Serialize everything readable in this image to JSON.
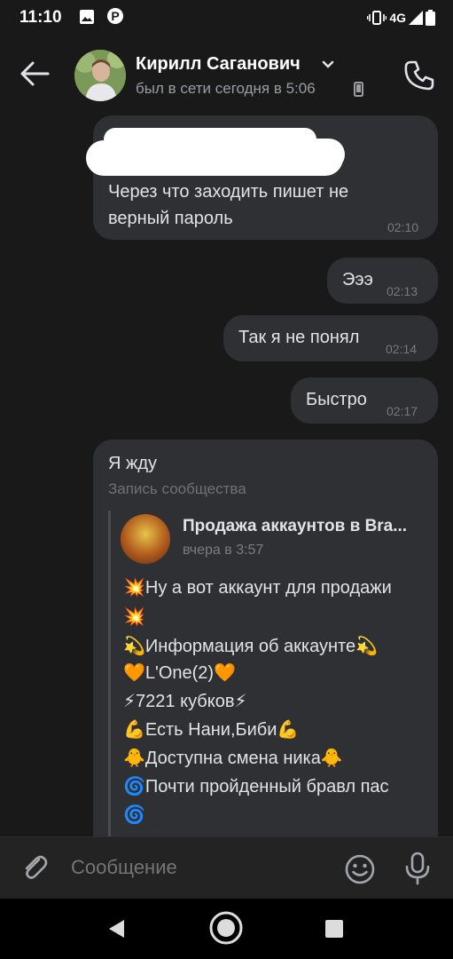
{
  "status_bar": {
    "time": "11:10",
    "network": "4G"
  },
  "header": {
    "contact_name": "Кирилл Саганович",
    "last_seen": "был в сети сегодня в 5:06"
  },
  "messages": [
    {
      "text": "Через что заходить пишет не верный пароль",
      "time": "02:10"
    },
    {
      "text": "Эээ",
      "time": "02:13"
    },
    {
      "text": "Так я не понял",
      "time": "02:14"
    },
    {
      "text": "Быстро",
      "time": "02:17"
    }
  ],
  "repost_message": {
    "text": "Я жду",
    "repost_label": "Запись сообщества",
    "group_name": "Продажа аккаунтов в Bra...",
    "group_date": "вчера в 3:57",
    "lines": [
      "💥Ну а вот аккаунт для продажи",
      "💥",
      "💫Информация об аккаунте💫",
      "🧡L'One(2)🧡",
      "⚡7221 кубков⚡",
      "💪Есть Нани,Биби💪",
      "🐥Доступна смена ника🐥",
      "🌀Почти пройденный бравл пас",
      "🌀"
    ]
  },
  "input": {
    "placeholder": "Сообщение"
  },
  "colors": {
    "background": "#191919",
    "bubble": "#2f3033",
    "text": "#e1e3e6",
    "muted": "#76787a"
  }
}
